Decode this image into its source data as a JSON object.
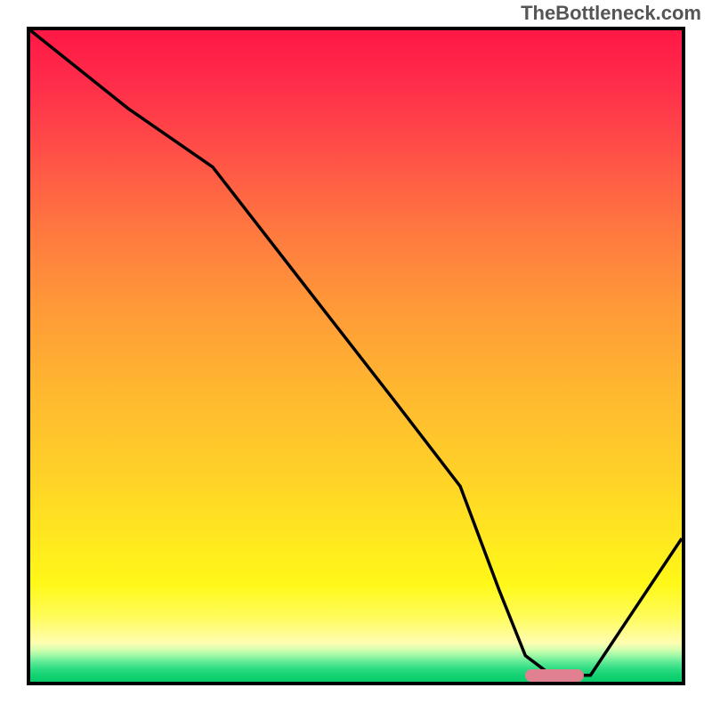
{
  "watermark": "TheBottleneck.com",
  "chart_data": {
    "type": "line",
    "title": "",
    "xlabel": "",
    "ylabel": "",
    "xlim": [
      0,
      100
    ],
    "ylim": [
      0,
      100
    ],
    "grid": false,
    "series": [
      {
        "name": "bottleneck-curve",
        "x": [
          0,
          15,
          28,
          42,
          56,
          66,
          72,
          76,
          80,
          86,
          92,
          100
        ],
        "values": [
          100,
          88,
          79,
          61,
          43,
          30,
          14,
          4,
          1,
          1,
          10,
          22
        ]
      }
    ],
    "marker": {
      "x_start": 76,
      "x_end": 85,
      "y": 1
    }
  },
  "colors": {
    "frame": "#000000",
    "curve": "#000000",
    "marker": "#e08090"
  }
}
